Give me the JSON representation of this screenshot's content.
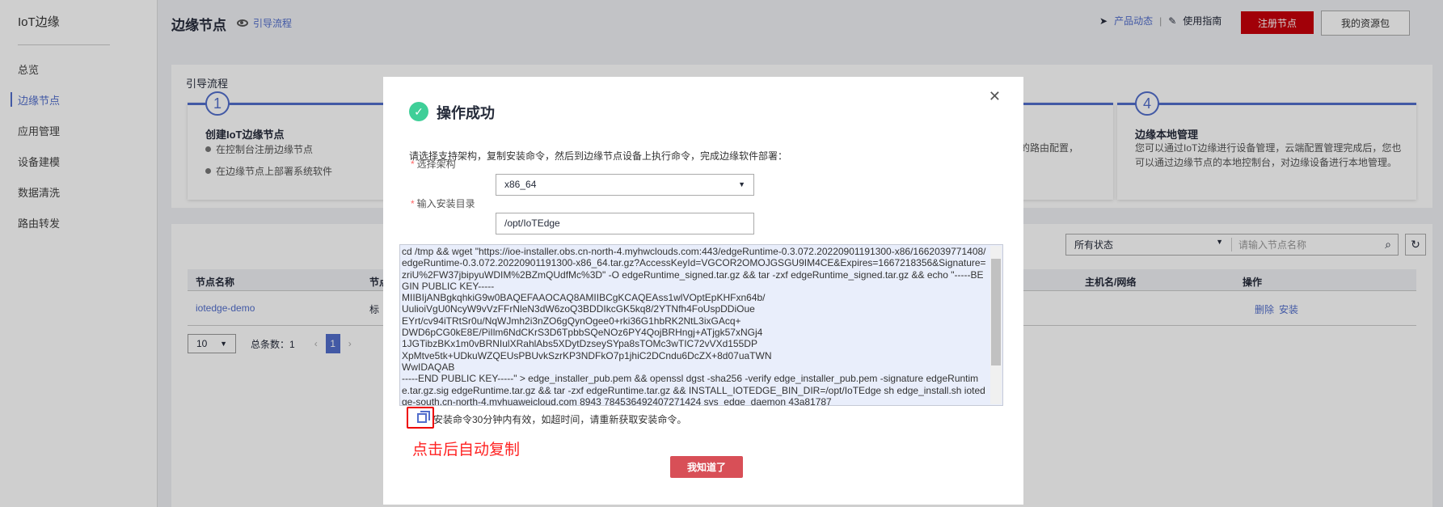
{
  "sidebar": {
    "brand": "IoT边缘",
    "items": [
      "总览",
      "边缘节点",
      "应用管理",
      "设备建模",
      "数据清洗",
      "路由转发"
    ]
  },
  "header": {
    "title": "边缘节点",
    "guide_link": "引导流程",
    "product_news": "产品动态",
    "separator": "|",
    "user_guide": "使用指南",
    "register_button": "注册节点",
    "resource_button": "我的资源包"
  },
  "guide": {
    "title": "引导流程",
    "steps": [
      {
        "num": "1",
        "title": "创建IoT边缘节点",
        "bullets": [
          "在控制台注册边缘节点",
          "在边缘节点上部署系统软件"
        ]
      },
      {
        "num": "4",
        "title": "边缘本地管理",
        "text": "您可以通过IoT边缘进行设备管理，云端配置管理完成后，您也可以通过边缘节点的本地控制台，对边缘设备进行本地管理。"
      }
    ],
    "partial_text": "的路由配置，"
  },
  "table": {
    "status_filter": "所有状态",
    "search_placeholder": "请输入节点名称",
    "columns": [
      "节点名称",
      "节点",
      "主机名/网络",
      "操作"
    ],
    "rows": [
      {
        "name": "iotedge-demo",
        "type": "标",
        "actions": [
          "删除",
          "安装"
        ]
      }
    ],
    "page_size": "10",
    "total": "总条数：1",
    "page": "1"
  },
  "modal": {
    "title": "操作成功",
    "description": "请选择支持架构，复制安装命令，然后到边缘节点设备上执行命令，完成边缘软件部署：",
    "arch_label": "选择架构",
    "arch_value": "x86_64",
    "dir_label": "输入安装目录",
    "dir_value": "/opt/IoTEdge",
    "command": "cd /tmp && wget \"https://ioe-installer.obs.cn-north-4.myhwclouds.com:443/edgeRuntime-0.3.072.20220901191300-x86/1662039771408/edgeRuntime-0.3.072.20220901191300-x86_64.tar.gz?AccessKeyId=VGCOR2OMOJGSGU9IM4CE&Expires=1667218356&Signature=zriU%2FW37jbipyuWDIM%2BZmQUdfMc%3D\" -O edgeRuntime_signed.tar.gz && tar -zxf edgeRuntime_signed.tar.gz && echo \"-----BEGIN PUBLIC KEY-----\nMIIBIjANBgkqhkiG9w0BAQEFAAOCAQ8AMIIBCgKCAQEAss1wlVOptEpKHFxn64b/\nUulioiVgU0NcyW9vVzFFrNleN3dW6zoQ3BDDIkcGK5kq8/2YTNfh4FoUspDDiOue\nEYrt/cv94iTRtSr0u/NqWJmh2i3nZO6gQynOgee0+rki36G1hbRK2NtL3ixGAcq+\nDWD6pCG0kE8E/PiIlm6NdCKrS3D6TpbbSQeNOz6PY4QojBRHngj+ATjgk57xNGj4\n1JGTibzBKx1m0vBRNIulXRahlAbs5XDytDzseySYpa8sTOMc3wTIC72vVXd155DP\nXpMtve5tk+UDkuWZQEUsPBUvkSzrKP3NDFkO7p1jhiC2DCndu6DcZX+8d07uaTWN\nWwIDAQAB\n-----END PUBLIC KEY-----\" > edge_installer_pub.pem && openssl dgst -sha256 -verify edge_installer_pub.pem -signature edgeRuntime.tar.gz.sig edgeRuntime.tar.gz && tar -zxf edgeRuntime.tar.gz && INSTALL_IOTEDGE_BIN_DIR=/opt/IoTEdge sh edge_install.sh iotedge-south.cn-north-4.myhuaweicloud.com 8943 784536492407271424 sys_edge_daemon 43a81787",
    "tip": "安装命令30分钟内有效，如超时间，请重新获取安装命令。",
    "annotation": "点击后自动复制",
    "ok_button": "我知道了"
  }
}
